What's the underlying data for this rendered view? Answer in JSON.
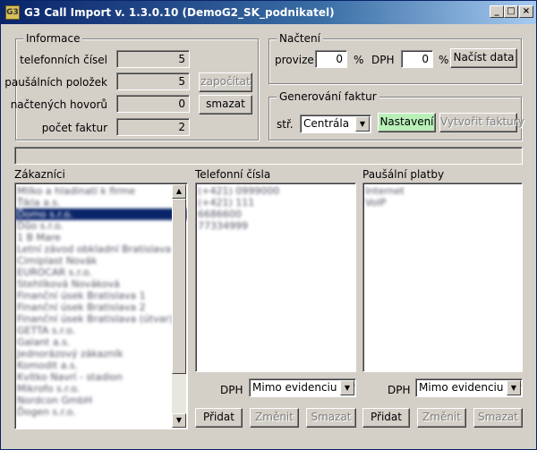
{
  "window": {
    "title": "G3 Call Import v. 1.3.0.10 (DemoG2_SK_podnikatel)",
    "minimize_glyph": "_",
    "maximize_glyph": "□",
    "close_glyph": "×"
  },
  "informace": {
    "title": "Informace",
    "rows": [
      {
        "label": "telefonních čísel",
        "value": "5"
      },
      {
        "label": "paušálních položek",
        "value": "5"
      },
      {
        "label": "načtených hovorů",
        "value": "0"
      },
      {
        "label": "počet faktur",
        "value": "2"
      }
    ],
    "zapocitat_label": "započítat",
    "smazat_label": "smazat"
  },
  "nacteni": {
    "title": "Načtení",
    "provize_label": "provize",
    "provize_value": "0",
    "percent1": "%",
    "dph_label": "DPH",
    "dph_value": "0",
    "percent2": "%",
    "nacist_label": "Načíst data"
  },
  "generovani": {
    "title": "Generování faktur",
    "str_label": "stř.",
    "str_value": "Centrála",
    "nastaveni_label": "Nastavení",
    "vytvorit_label": "Vytvořit faktury"
  },
  "zakaznici": {
    "title": "Zákazníci",
    "items": [
      "Mlíko a hladinatí k firme",
      "Ťikla a.s.",
      "Ďomo s.r.o.",
      "Ďůo s.r.o.",
      "1 B Mare",
      "Letní závod obkladní Bratislava",
      "Cimiplast Novák",
      "EUROCAR s.r.o.",
      "Stehlíková Nováková",
      "Finanční úsek Bratislava 1",
      "Finanční úsek Bratislava 2",
      "Finanční úsek Bratislava (útvar)",
      "GETTA s.r.o.",
      "Galant a.s.",
      "Jednorázový zákazník",
      "Komodit a.s.",
      "Kvítko Navrí - stadion",
      "Mikrofo s.r.o.",
      "Nordcon GmbH",
      "Ďogen s.r.o."
    ],
    "selected_index": 2
  },
  "telefonni": {
    "title": "Telefonní čísla",
    "items": [
      "(+421) 0999000",
      "(+421) 111",
      "6686600",
      "77334999"
    ],
    "dph_label": "DPH",
    "dph_value": "Mimo evidenciu DPH",
    "pridat": "Přidat",
    "zmenit": "Změnit",
    "smazat": "Smazat"
  },
  "pausalni": {
    "title": "Paušální platby",
    "items": [
      "Internet",
      "VoIP"
    ],
    "dph_label": "DPH",
    "dph_value": "Mimo evidenciu DPH",
    "pridat": "Přidat",
    "zmenit": "Změnit",
    "smazat": "Smazat"
  },
  "icons": {
    "dropdown": "▼",
    "scroll_up": "▲",
    "scroll_down": "▼"
  }
}
